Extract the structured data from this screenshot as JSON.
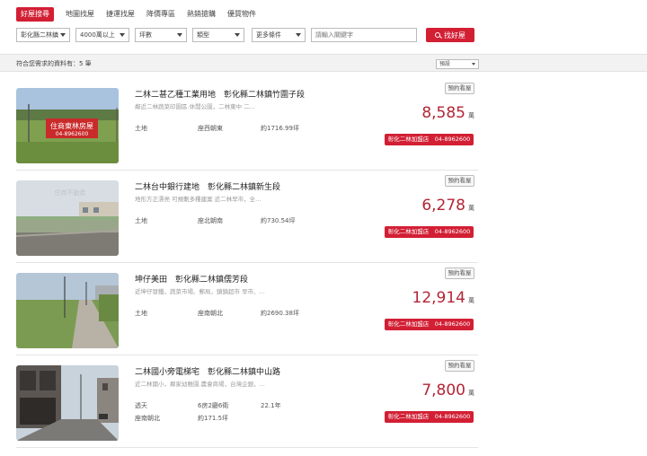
{
  "nav": {
    "tabs": [
      {
        "label": "好屋搜尋"
      },
      {
        "label": "地圖找屋"
      },
      {
        "label": "捷運找屋"
      },
      {
        "label": "降價專區"
      },
      {
        "label": "熱銷搶購"
      },
      {
        "label": "優質物件"
      }
    ]
  },
  "filters": {
    "region": "彰化縣二林鎮",
    "price": "4000萬以上",
    "area": "坪數",
    "type": "類型",
    "more": "更多條件",
    "keyword_placeholder": "請輸入關鍵字",
    "search_label": "找好屋"
  },
  "results": {
    "text": "符合您需求的資料有：5 筆",
    "sort": "預設"
  },
  "colors": {
    "accent": "#d21f34",
    "price": "#b32535"
  },
  "listings": [
    {
      "title": "二林二甚乙種工業用地　彰化縣二林鎮竹圍子段",
      "desc": "鄰近二林蔬菜印園區.休閒公園，二林東中 二...",
      "type": "土地",
      "direction": "座西朝東",
      "area": "約1716.99坪",
      "appointment": "預約看屋",
      "price": "8,585",
      "unit": "萬",
      "store": "彰化二林加盟店　04-8962600",
      "sign_text": "住商東林房屋",
      "sign_phone": "04-8962600"
    },
    {
      "title": "二林台中銀行建地　彰化縣二林鎮新生段",
      "desc": "地形方正漂亮 可規劃多種建案 近二林早市，全...",
      "type": "土地",
      "direction": "座北朝南",
      "area": "約730.54坪",
      "appointment": "預約看屋",
      "price": "6,278",
      "unit": "萬",
      "store": "彰化二林加盟店　04-8962600",
      "watermark": "住商不動產"
    },
    {
      "title": "坤仔美田　彰化縣二林鎮儒芳段",
      "desc": "近坤仔發鐵，蔬菜市場、郵局，鎮鎮超市 早市、...",
      "type": "土地",
      "direction": "座南朝北",
      "area": "約2690.38坪",
      "appointment": "預約看屋",
      "price": "12,914",
      "unit": "萬",
      "store": "彰化二林加盟店　04-8962600"
    },
    {
      "title": "二林國小旁電梯宅　彰化縣二林鎮中山路",
      "desc": "近二林國小，鄰家幼稚園.農會商場，台灣企銀，...",
      "type": "透天",
      "layout": "6房2廳6衛",
      "age": "22.1年",
      "direction": "座南朝北",
      "area": "約171.5坪",
      "appointment": "預約看屋",
      "price": "7,800",
      "unit": "萬",
      "store": "彰化二林加盟店　04-8962600"
    }
  ]
}
